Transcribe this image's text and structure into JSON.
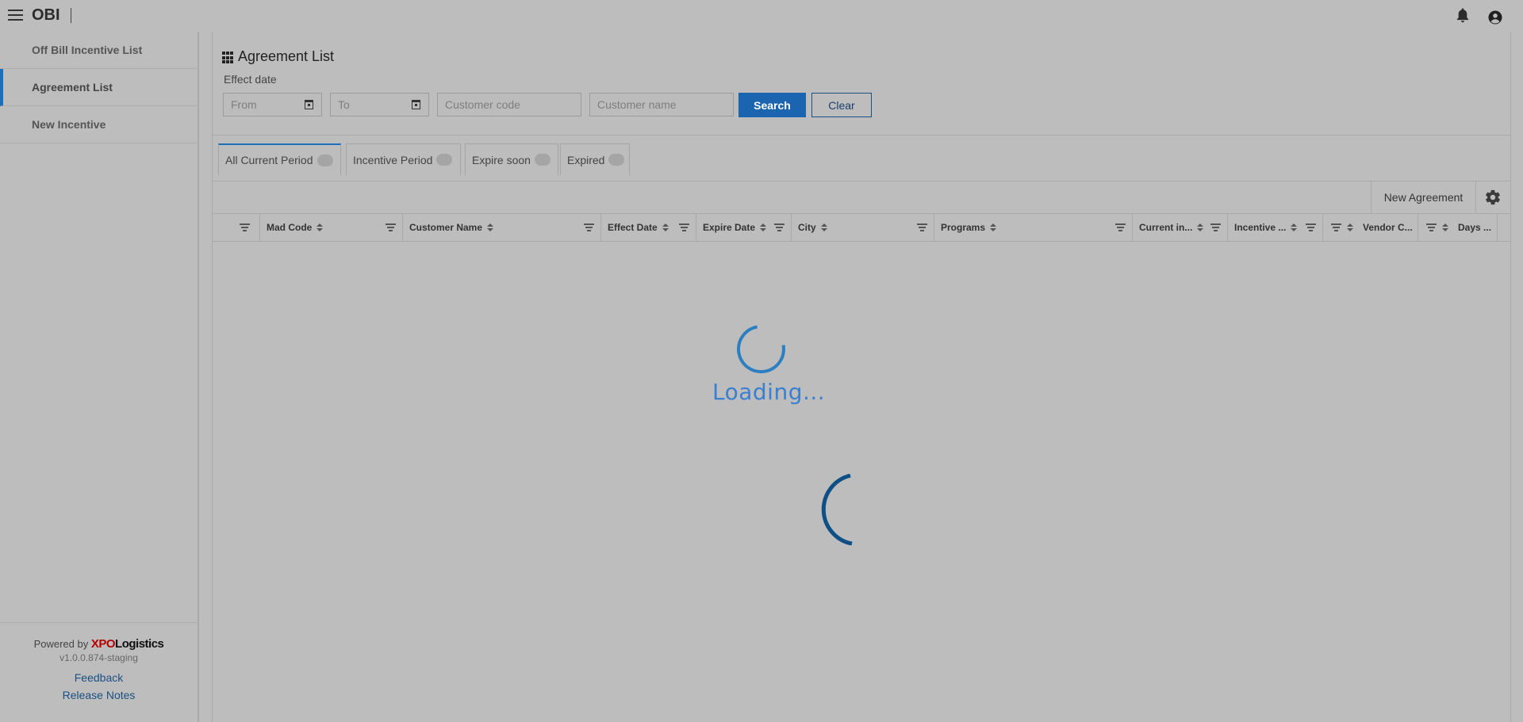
{
  "app": {
    "title": "OBI"
  },
  "sidebar": {
    "items": [
      {
        "label": "Off Bill Incentive List"
      },
      {
        "label": "Agreement List"
      },
      {
        "label": "New Incentive"
      }
    ],
    "footer": {
      "powered_by": "Powered by",
      "logo_x": "XPO",
      "logo_rest": "Logistics",
      "version": "v1.0.0.874-staging",
      "feedback": "Feedback",
      "release_notes": "Release Notes"
    }
  },
  "header": {
    "title": "Agreement List",
    "effect_date_label": "Effect date",
    "from_placeholder": "From",
    "to_placeholder": "To",
    "customer_code_placeholder": "Customer code",
    "customer_name_placeholder": "Customer name",
    "search_label": "Search",
    "clear_label": "Clear"
  },
  "tabs": [
    {
      "label": "All Current Period"
    },
    {
      "label": "Incentive Period"
    },
    {
      "label": "Expire soon"
    },
    {
      "label": "Expired"
    }
  ],
  "toolbar": {
    "new_agreement_label": "New Agreement"
  },
  "columns": [
    {
      "label": "Mad Code"
    },
    {
      "label": "Customer Name"
    },
    {
      "label": "Effect Date"
    },
    {
      "label": "Expire Date"
    },
    {
      "label": "City"
    },
    {
      "label": "Programs"
    },
    {
      "label": "Current in..."
    },
    {
      "label": "Incentive ..."
    },
    {
      "label": "Vendor C..."
    },
    {
      "label": "Days ..."
    }
  ],
  "loading": {
    "text": "Loading..."
  },
  "colors": {
    "accent": "#1a64b0",
    "background": "#bdbdbd",
    "spinner": "#2d7fc1",
    "logo_red": "#b50000"
  }
}
